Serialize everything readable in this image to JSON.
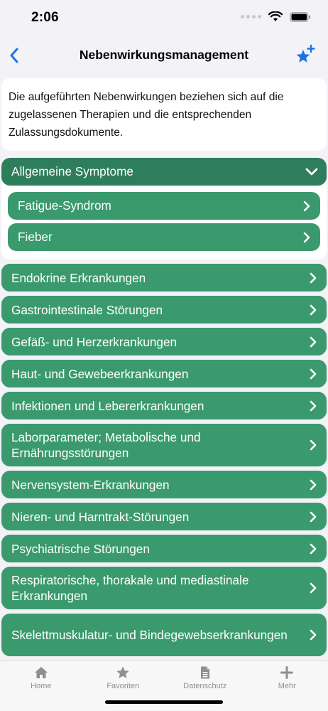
{
  "status": {
    "time": "2:06"
  },
  "nav": {
    "title": "Nebenwirkungsmanagement"
  },
  "info": {
    "text": "Die aufgeführten Nebenwirkungen beziehen sich auf die zugelassenen Therapien und die entsprechenden Zulassungsdokumente."
  },
  "expanded": {
    "label": "Allgemeine Symptome",
    "items": [
      "Fatigue-Syndrom",
      "Fieber"
    ]
  },
  "categories": [
    "Endokrine Erkrankungen",
    "Gastrointestinale Störungen",
    "Gefäß- und Herzerkrankungen",
    "Haut- und Gewebeerkrankungen",
    "Infektionen und Lebererkrankungen",
    "Laborparameter; Metabolische und Ernährungsstörungen",
    "Nervensystem-Erkrankungen",
    "Nieren- und Harntrakt-Störungen",
    "Psychiatrische Störungen",
    "Respiratorische, thorakale und mediastinale Erkrankungen",
    "Skelettmuskulatur- und Bindegewebserkrankungen"
  ],
  "tabs": [
    "Home",
    "Favoriten",
    "Datenschutz",
    "Mehr"
  ],
  "colors": {
    "accent": "#3a9a6d",
    "accent_dark": "#2e7d5b",
    "link": "#1a73e8"
  },
  "icons": {
    "back": "chevron-left-icon",
    "favorite": "star-plus-icon",
    "row": "chevron-right-icon",
    "expanded": "chevron-down-icon"
  }
}
